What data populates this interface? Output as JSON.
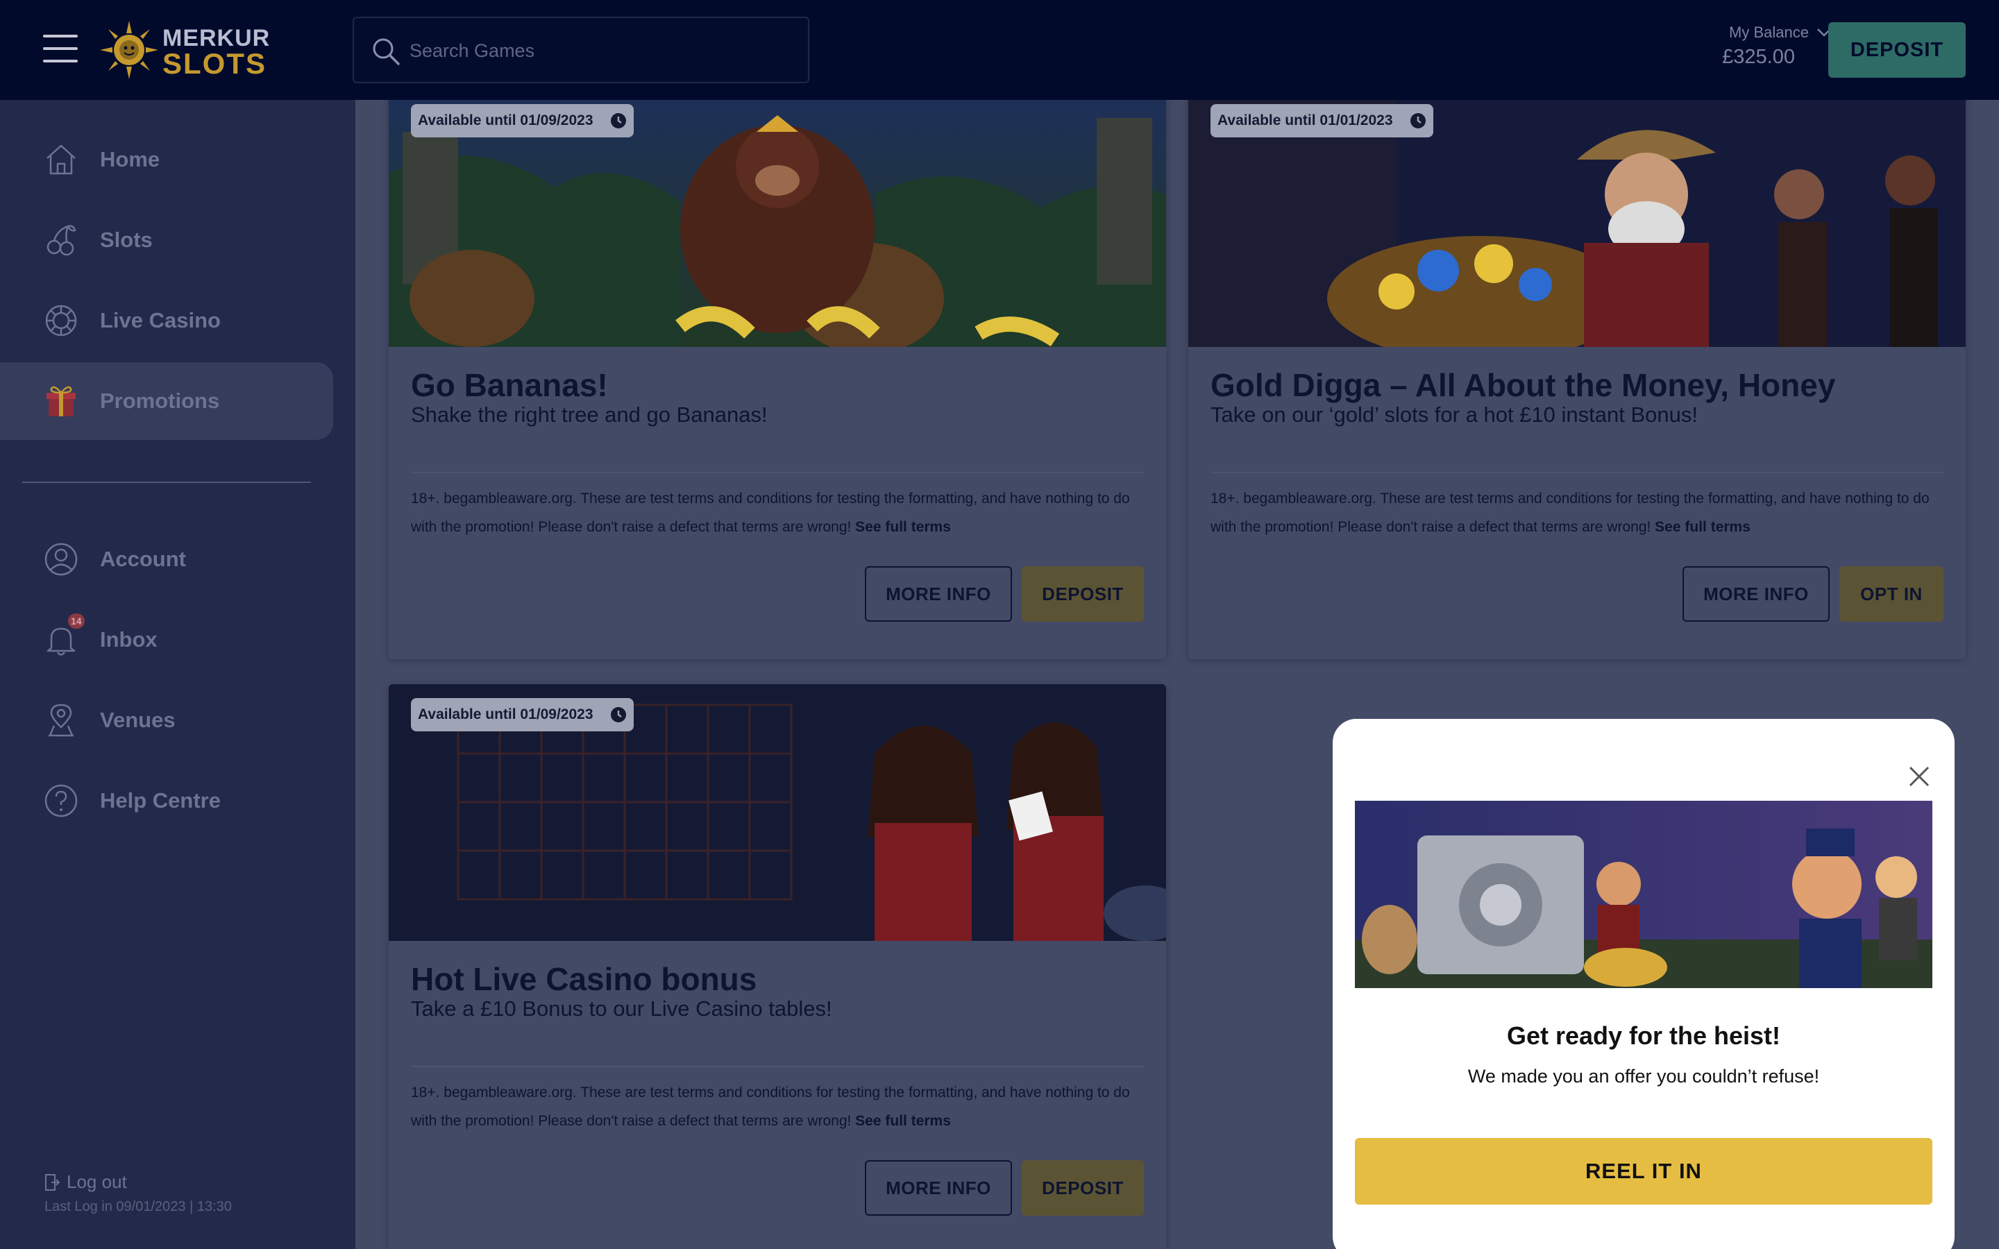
{
  "header": {
    "menu_icon": "hamburger-menu-icon",
    "logo": {
      "line1": "MERKUR",
      "line2": "SLOTS"
    },
    "search": {
      "placeholder": "Search Games",
      "icon": "search-icon"
    },
    "balance": {
      "label": "My Balance",
      "value": "£325.00"
    },
    "deposit_label": "DEPOSIT",
    "deposit_color": "#2e6b65"
  },
  "sidebar": {
    "items": [
      {
        "label": "Home",
        "icon": "home-icon"
      },
      {
        "label": "Slots",
        "icon": "cherries-icon"
      },
      {
        "label": "Live Casino",
        "icon": "casino-chip-icon"
      },
      {
        "label": "Promotions",
        "icon": "gift-icon",
        "active": true
      },
      {
        "label": "Account",
        "icon": "user-icon"
      },
      {
        "label": "Inbox",
        "icon": "bell-icon",
        "badge": "14"
      },
      {
        "label": "Venues",
        "icon": "location-pin-icon"
      },
      {
        "label": "Help Centre",
        "icon": "help-icon"
      }
    ],
    "logout_label": "Log out",
    "last_login": "Last Log in 09/01/2023 | 13:30"
  },
  "promotions": [
    {
      "available": "Available until 01/09/2023",
      "title": "Go Bananas!",
      "subtitle": "Shake the right tree and go Bananas!",
      "terms": "18+. begambleaware.org. These are test terms and conditions for testing the formatting, and have nothing to do with the promotion! Please don't raise a defect that terms are wrong!",
      "terms_link": "See full terms",
      "info_label": "MORE INFO",
      "action_label": "DEPOSIT"
    },
    {
      "available": "Available until 01/01/2023",
      "title": "Gold Digga – All About the Money, Honey",
      "subtitle": "Take on our ‘gold’ slots for a hot £10 instant Bonus!",
      "terms": "18+. begambleaware.org. These are test terms and conditions for testing the formatting, and have nothing to do with the promotion! Please don't raise a defect that terms are wrong!",
      "terms_link": "See full terms",
      "info_label": "MORE INFO",
      "action_label": "OPT IN"
    },
    {
      "available": "Available until 01/09/2023",
      "title": "Hot Live Casino bonus",
      "subtitle": "Take a £10 Bonus to our Live Casino tables!",
      "terms": "18+. begambleaware.org. These are test terms and conditions for testing the formatting, and have nothing to do with the promotion! Please don't raise a defect that terms are wrong!",
      "terms_link": "See full terms",
      "info_label": "MORE INFO",
      "action_label": "DEPOSIT"
    }
  ],
  "modal": {
    "title": "Get ready for the heist!",
    "text": "We made you an offer you couldn’t refuse!",
    "button_label": "REEL IT IN",
    "button_color": "#e5bd42",
    "close_icon": "close-icon"
  }
}
